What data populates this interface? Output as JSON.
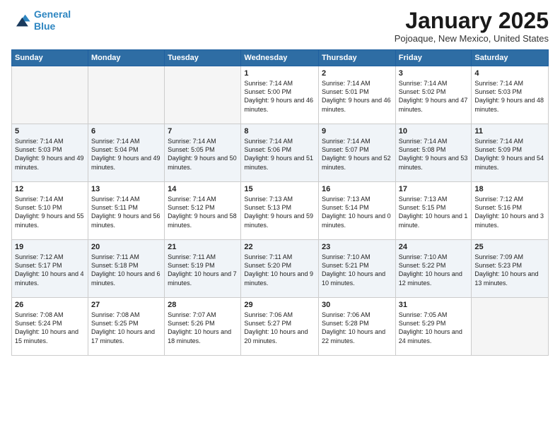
{
  "logo": {
    "line1": "General",
    "line2": "Blue"
  },
  "title": "January 2025",
  "location": "Pojoaque, New Mexico, United States",
  "weekdays": [
    "Sunday",
    "Monday",
    "Tuesday",
    "Wednesday",
    "Thursday",
    "Friday",
    "Saturday"
  ],
  "weeks": [
    [
      {
        "day": "",
        "info": ""
      },
      {
        "day": "",
        "info": ""
      },
      {
        "day": "",
        "info": ""
      },
      {
        "day": "1",
        "info": "Sunrise: 7:14 AM\nSunset: 5:00 PM\nDaylight: 9 hours and 46 minutes."
      },
      {
        "day": "2",
        "info": "Sunrise: 7:14 AM\nSunset: 5:01 PM\nDaylight: 9 hours and 46 minutes."
      },
      {
        "day": "3",
        "info": "Sunrise: 7:14 AM\nSunset: 5:02 PM\nDaylight: 9 hours and 47 minutes."
      },
      {
        "day": "4",
        "info": "Sunrise: 7:14 AM\nSunset: 5:03 PM\nDaylight: 9 hours and 48 minutes."
      }
    ],
    [
      {
        "day": "5",
        "info": "Sunrise: 7:14 AM\nSunset: 5:03 PM\nDaylight: 9 hours and 49 minutes."
      },
      {
        "day": "6",
        "info": "Sunrise: 7:14 AM\nSunset: 5:04 PM\nDaylight: 9 hours and 49 minutes."
      },
      {
        "day": "7",
        "info": "Sunrise: 7:14 AM\nSunset: 5:05 PM\nDaylight: 9 hours and 50 minutes."
      },
      {
        "day": "8",
        "info": "Sunrise: 7:14 AM\nSunset: 5:06 PM\nDaylight: 9 hours and 51 minutes."
      },
      {
        "day": "9",
        "info": "Sunrise: 7:14 AM\nSunset: 5:07 PM\nDaylight: 9 hours and 52 minutes."
      },
      {
        "day": "10",
        "info": "Sunrise: 7:14 AM\nSunset: 5:08 PM\nDaylight: 9 hours and 53 minutes."
      },
      {
        "day": "11",
        "info": "Sunrise: 7:14 AM\nSunset: 5:09 PM\nDaylight: 9 hours and 54 minutes."
      }
    ],
    [
      {
        "day": "12",
        "info": "Sunrise: 7:14 AM\nSunset: 5:10 PM\nDaylight: 9 hours and 55 minutes."
      },
      {
        "day": "13",
        "info": "Sunrise: 7:14 AM\nSunset: 5:11 PM\nDaylight: 9 hours and 56 minutes."
      },
      {
        "day": "14",
        "info": "Sunrise: 7:14 AM\nSunset: 5:12 PM\nDaylight: 9 hours and 58 minutes."
      },
      {
        "day": "15",
        "info": "Sunrise: 7:13 AM\nSunset: 5:13 PM\nDaylight: 9 hours and 59 minutes."
      },
      {
        "day": "16",
        "info": "Sunrise: 7:13 AM\nSunset: 5:14 PM\nDaylight: 10 hours and 0 minutes."
      },
      {
        "day": "17",
        "info": "Sunrise: 7:13 AM\nSunset: 5:15 PM\nDaylight: 10 hours and 1 minute."
      },
      {
        "day": "18",
        "info": "Sunrise: 7:12 AM\nSunset: 5:16 PM\nDaylight: 10 hours and 3 minutes."
      }
    ],
    [
      {
        "day": "19",
        "info": "Sunrise: 7:12 AM\nSunset: 5:17 PM\nDaylight: 10 hours and 4 minutes."
      },
      {
        "day": "20",
        "info": "Sunrise: 7:11 AM\nSunset: 5:18 PM\nDaylight: 10 hours and 6 minutes."
      },
      {
        "day": "21",
        "info": "Sunrise: 7:11 AM\nSunset: 5:19 PM\nDaylight: 10 hours and 7 minutes."
      },
      {
        "day": "22",
        "info": "Sunrise: 7:11 AM\nSunset: 5:20 PM\nDaylight: 10 hours and 9 minutes."
      },
      {
        "day": "23",
        "info": "Sunrise: 7:10 AM\nSunset: 5:21 PM\nDaylight: 10 hours and 10 minutes."
      },
      {
        "day": "24",
        "info": "Sunrise: 7:10 AM\nSunset: 5:22 PM\nDaylight: 10 hours and 12 minutes."
      },
      {
        "day": "25",
        "info": "Sunrise: 7:09 AM\nSunset: 5:23 PM\nDaylight: 10 hours and 13 minutes."
      }
    ],
    [
      {
        "day": "26",
        "info": "Sunrise: 7:08 AM\nSunset: 5:24 PM\nDaylight: 10 hours and 15 minutes."
      },
      {
        "day": "27",
        "info": "Sunrise: 7:08 AM\nSunset: 5:25 PM\nDaylight: 10 hours and 17 minutes."
      },
      {
        "day": "28",
        "info": "Sunrise: 7:07 AM\nSunset: 5:26 PM\nDaylight: 10 hours and 18 minutes."
      },
      {
        "day": "29",
        "info": "Sunrise: 7:06 AM\nSunset: 5:27 PM\nDaylight: 10 hours and 20 minutes."
      },
      {
        "day": "30",
        "info": "Sunrise: 7:06 AM\nSunset: 5:28 PM\nDaylight: 10 hours and 22 minutes."
      },
      {
        "day": "31",
        "info": "Sunrise: 7:05 AM\nSunset: 5:29 PM\nDaylight: 10 hours and 24 minutes."
      },
      {
        "day": "",
        "info": ""
      }
    ]
  ]
}
